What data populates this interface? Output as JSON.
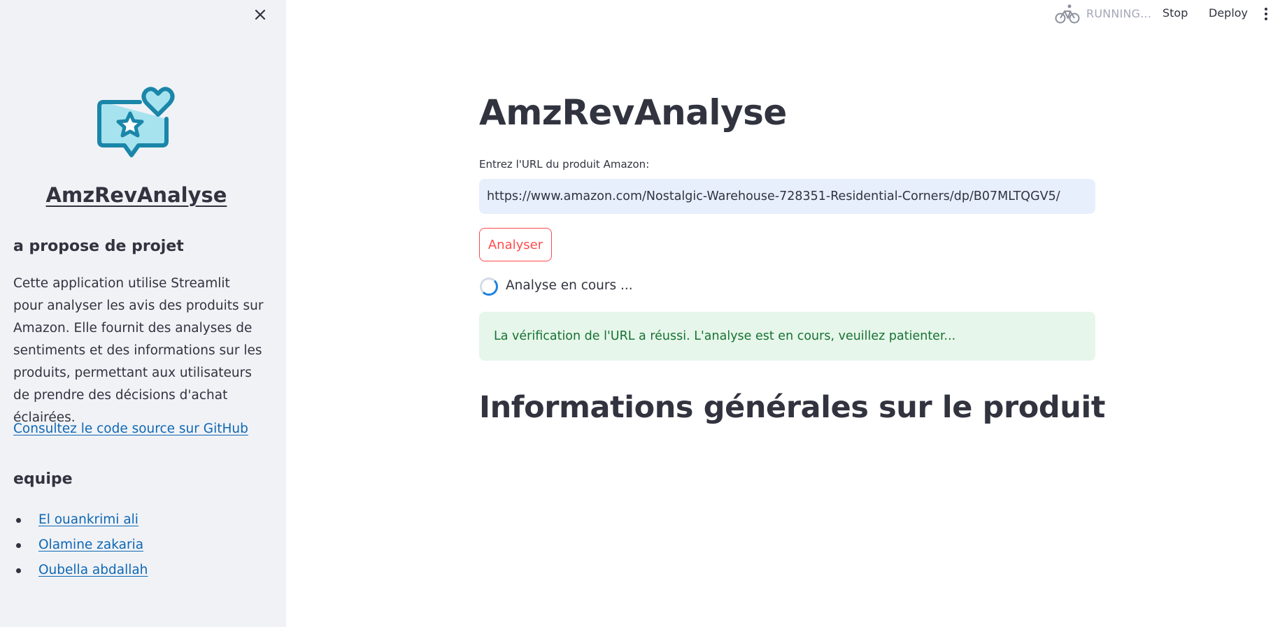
{
  "sidebar": {
    "logo_icon": "chat-star-heart-icon",
    "close_icon": "close-icon",
    "title": "AmzRevAnalyse",
    "about_heading": "a propose de projet",
    "about_text": "Cette application utilise Streamlit pour analyser les avis des produits sur Amazon. Elle fournit des analyses de sentiments et des informations sur les produits, permettant aux utilisateurs de prendre des décisions d'achat éclairées.",
    "github_link": "Consultez le code source sur GitHub",
    "team_heading": "equipe",
    "team": [
      "El ouankrimi ali",
      "Olamine zakaria",
      "Oubella abdallah"
    ]
  },
  "header": {
    "status_icon": "bicycle-icon",
    "status_text": "RUNNING...",
    "stop_label": "Stop",
    "deploy_label": "Deploy",
    "menu_icon": "more-vert-icon"
  },
  "main": {
    "title": "AmzRevAnalyse",
    "url_label": "Entrez l'URL du produit Amazon:",
    "url_value": "https://www.amazon.com/Nostalgic-Warehouse-728351-Residential-Corners/dp/B07MLTQGV5/",
    "analyse_button": "Analyser",
    "spinner_text": "Analyse en cours ...",
    "success_message": "La vérification de l'URL a réussi. L'analyse est en cours, veuillez patienter...",
    "section_heading": "Informations générales sur le produit"
  },
  "colors": {
    "sidebar_bg": "#f0f2f6",
    "primary": "#ff4b4b",
    "link": "#0e67b4",
    "success_bg": "#e6f6ea",
    "success_text": "#177233",
    "input_bg": "#e8effc",
    "logo": "#1a86a9"
  }
}
